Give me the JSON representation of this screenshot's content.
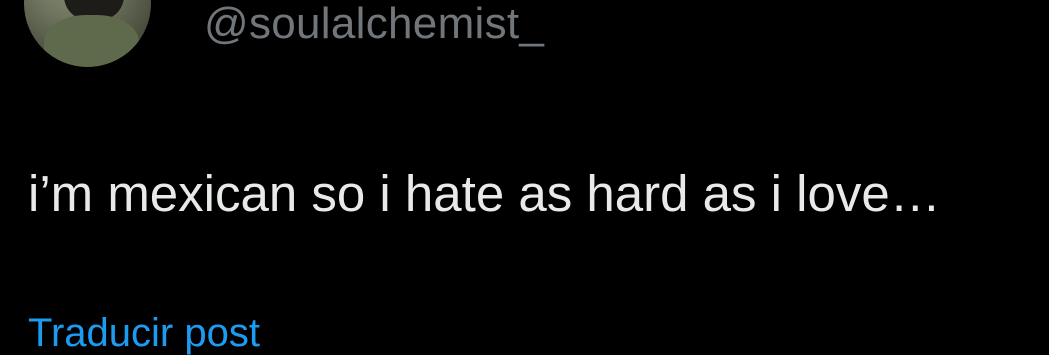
{
  "author": {
    "handle": "@soulalchemist_",
    "avatar_icon": "user-avatar"
  },
  "tweet": {
    "text": "i’m mexican so i hate as hard as i love…"
  },
  "actions": {
    "translate_label": "Traducir post"
  },
  "colors": {
    "background": "#000000",
    "primary_text": "#e7e9ea",
    "secondary_text": "#71767b",
    "link": "#1d9bf0"
  }
}
